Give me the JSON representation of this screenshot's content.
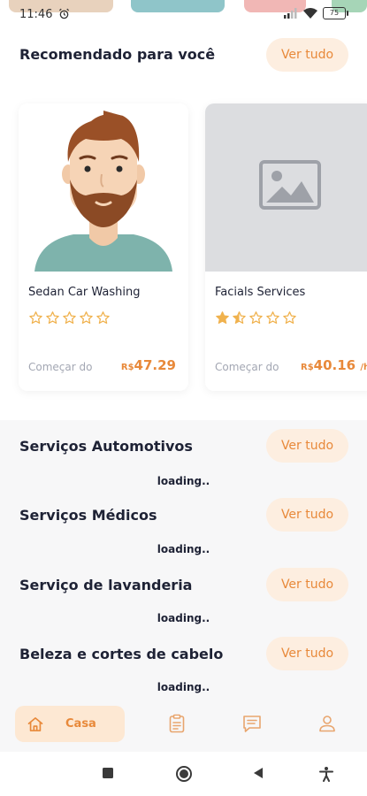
{
  "status_bar": {
    "time": "11:46",
    "battery": "75"
  },
  "recommended": {
    "title": "Recomendado para você",
    "see_all": "Ver tudo",
    "cards": [
      {
        "title": "Sedan Car Washing",
        "rating": 0,
        "from_label": "Começar do",
        "currency": "R$",
        "price": "47.29",
        "unit": "",
        "image": "avatar-illustration"
      },
      {
        "title": "Facials Services",
        "rating": 1.5,
        "from_label": "Começar do",
        "currency": "R$",
        "price": "40.16",
        "unit": "/h",
        "image": "image-placeholder-icon"
      }
    ]
  },
  "sections": [
    {
      "title": "Serviços Automotivos",
      "see_all": "Ver tudo",
      "status": "loading.."
    },
    {
      "title": "Serviços Médicos",
      "see_all": "Ver tudo",
      "status": "loading.."
    },
    {
      "title": "Serviço de lavanderia",
      "see_all": "Ver tudo",
      "status": "loading.."
    },
    {
      "title": "Beleza e cortes de cabelo",
      "see_all": "Ver tudo",
      "status": "loading.."
    }
  ],
  "bottom_nav": {
    "home_label": "Casa",
    "icons": [
      "home-icon",
      "clipboard-icon",
      "chat-icon",
      "profile-icon"
    ]
  },
  "colors": {
    "accent": "#e8893a",
    "accent_soft": "#fdeee0",
    "text": "#1e2235",
    "muted": "#a3a7b3"
  }
}
